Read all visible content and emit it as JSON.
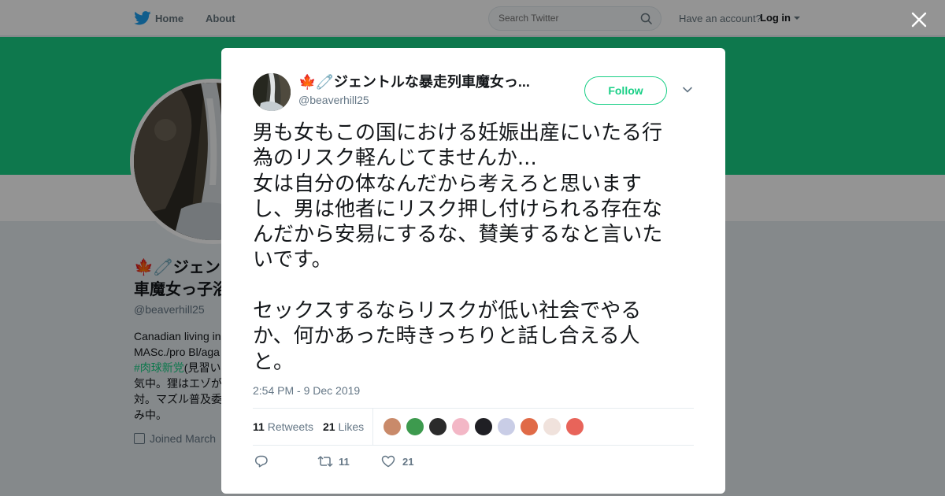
{
  "nav": {
    "home": "Home",
    "about": "About",
    "search_placeholder": "Search Twitter",
    "have_account": "Have an account?",
    "login": "Log in"
  },
  "profile": {
    "name_line1": "🍁🧷ジェントルな暴走列車魔女っ子浴",
    "name_line2": "車魔女っ子浴",
    "handle": "@beaverhill25",
    "bio_lines": [
      "Canadian living in",
      "MASc./pro Bl/aga",
      "#肉球新党(見習い",
      "気中。狸はエゾが",
      "対。マズル普及委",
      "み中。"
    ],
    "bio_hashtag": "#肉球新党",
    "joined": "Joined March"
  },
  "tweet": {
    "author_name": "🍁🧷ジェントルな暴走列車魔女っ...",
    "author_handle": "@beaverhill25",
    "follow_label": "Follow",
    "text_lines": [
      "男も女もこの国における妊娠出産にいたる行",
      "為のリスク軽んじてませんか...",
      "女は自分の体なんだから考えろと思います",
      "し、男は他者にリスク押し付けられる存在な",
      "んだから安易にするな、賛美するなと言いた",
      "いです。",
      "",
      "セックスするならリスクが低い社会でやる",
      "か、何かあった時きっちりと話し合える人",
      "と。"
    ],
    "timestamp": "2:54 PM - 9 Dec 2019",
    "retweets_count": "11",
    "retweets_label": "Retweets",
    "likes_count": "21",
    "likes_label": "Likes",
    "reply_count": "",
    "retweet_action_count": "11",
    "like_action_count": "21"
  },
  "colors": {
    "accent": "#19cf86",
    "banner": "#19cf86",
    "text": "#14171a",
    "muted": "#657786"
  },
  "icons": {
    "logo": "twitter-bird-icon",
    "search": "search-icon",
    "close": "close-icon",
    "more": "chevron-down-icon",
    "reply": "reply-icon",
    "retweet": "retweet-icon",
    "like": "heart-icon",
    "joined": "calendar-icon"
  }
}
